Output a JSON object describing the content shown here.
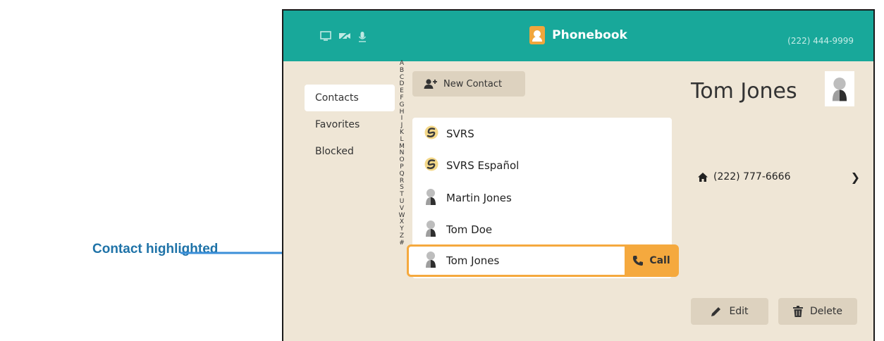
{
  "annotation": {
    "label": "Contact highlighted"
  },
  "header": {
    "title": "Phonebook",
    "phone_number": "(222) 444-9999",
    "status_icons": [
      "screen-icon",
      "video-off-icon",
      "mic-icon"
    ]
  },
  "nav": {
    "items": [
      {
        "label": "Contacts",
        "active": true
      },
      {
        "label": "Favorites",
        "active": false
      },
      {
        "label": "Blocked",
        "active": false
      }
    ]
  },
  "alphabet": [
    "A",
    "B",
    "C",
    "D",
    "E",
    "F",
    "G",
    "H",
    "I",
    "J",
    "K",
    "L",
    "M",
    "N",
    "O",
    "P",
    "Q",
    "R",
    "S",
    "T",
    "U",
    "V",
    "W",
    "X",
    "Y",
    "Z",
    "#"
  ],
  "new_contact_label": "New Contact",
  "contacts": [
    {
      "name": "SVRS",
      "avatar": "svrs-logo-icon",
      "highlighted": false
    },
    {
      "name": "SVRS Español",
      "avatar": "svrs-logo-icon",
      "highlighted": false
    },
    {
      "name": "Martin Jones",
      "avatar": "person-icon",
      "highlighted": false
    },
    {
      "name": "Tom Doe",
      "avatar": "person-icon",
      "highlighted": false
    },
    {
      "name": "Tom Jones",
      "avatar": "person-icon",
      "highlighted": true
    }
  ],
  "call_label": "Call",
  "detail": {
    "name": "Tom Jones",
    "phone_type_icon": "home-icon",
    "phone": "(222) 777-6666",
    "edit_label": "Edit",
    "delete_label": "Delete"
  },
  "colors": {
    "teal": "#18a89a",
    "orange": "#f5a93e",
    "background": "#efe6d6",
    "annotation": "#1f73a8"
  }
}
